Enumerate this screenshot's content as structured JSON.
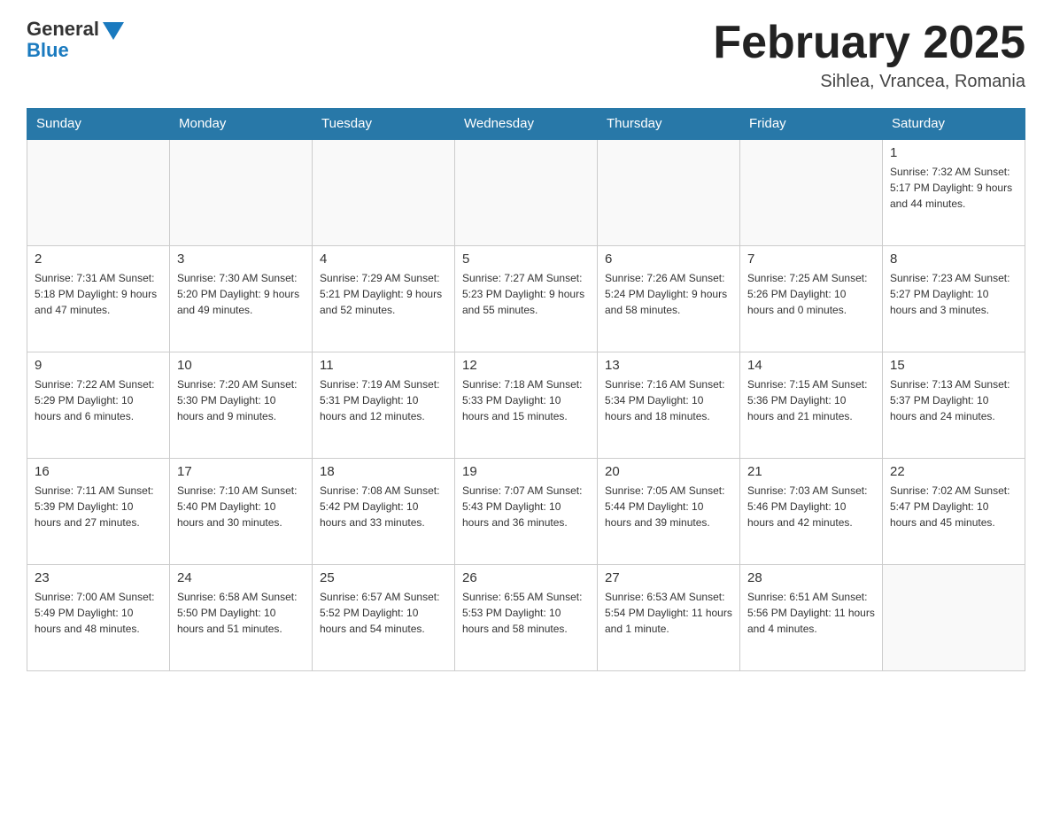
{
  "header": {
    "logo_general": "General",
    "logo_blue": "Blue",
    "month_title": "February 2025",
    "location": "Sihlea, Vrancea, Romania"
  },
  "days_of_week": [
    "Sunday",
    "Monday",
    "Tuesday",
    "Wednesday",
    "Thursday",
    "Friday",
    "Saturday"
  ],
  "weeks": [
    {
      "days": [
        {
          "number": "",
          "info": ""
        },
        {
          "number": "",
          "info": ""
        },
        {
          "number": "",
          "info": ""
        },
        {
          "number": "",
          "info": ""
        },
        {
          "number": "",
          "info": ""
        },
        {
          "number": "",
          "info": ""
        },
        {
          "number": "1",
          "info": "Sunrise: 7:32 AM\nSunset: 5:17 PM\nDaylight: 9 hours and 44 minutes."
        }
      ]
    },
    {
      "days": [
        {
          "number": "2",
          "info": "Sunrise: 7:31 AM\nSunset: 5:18 PM\nDaylight: 9 hours and 47 minutes."
        },
        {
          "number": "3",
          "info": "Sunrise: 7:30 AM\nSunset: 5:20 PM\nDaylight: 9 hours and 49 minutes."
        },
        {
          "number": "4",
          "info": "Sunrise: 7:29 AM\nSunset: 5:21 PM\nDaylight: 9 hours and 52 minutes."
        },
        {
          "number": "5",
          "info": "Sunrise: 7:27 AM\nSunset: 5:23 PM\nDaylight: 9 hours and 55 minutes."
        },
        {
          "number": "6",
          "info": "Sunrise: 7:26 AM\nSunset: 5:24 PM\nDaylight: 9 hours and 58 minutes."
        },
        {
          "number": "7",
          "info": "Sunrise: 7:25 AM\nSunset: 5:26 PM\nDaylight: 10 hours and 0 minutes."
        },
        {
          "number": "8",
          "info": "Sunrise: 7:23 AM\nSunset: 5:27 PM\nDaylight: 10 hours and 3 minutes."
        }
      ]
    },
    {
      "days": [
        {
          "number": "9",
          "info": "Sunrise: 7:22 AM\nSunset: 5:29 PM\nDaylight: 10 hours and 6 minutes."
        },
        {
          "number": "10",
          "info": "Sunrise: 7:20 AM\nSunset: 5:30 PM\nDaylight: 10 hours and 9 minutes."
        },
        {
          "number": "11",
          "info": "Sunrise: 7:19 AM\nSunset: 5:31 PM\nDaylight: 10 hours and 12 minutes."
        },
        {
          "number": "12",
          "info": "Sunrise: 7:18 AM\nSunset: 5:33 PM\nDaylight: 10 hours and 15 minutes."
        },
        {
          "number": "13",
          "info": "Sunrise: 7:16 AM\nSunset: 5:34 PM\nDaylight: 10 hours and 18 minutes."
        },
        {
          "number": "14",
          "info": "Sunrise: 7:15 AM\nSunset: 5:36 PM\nDaylight: 10 hours and 21 minutes."
        },
        {
          "number": "15",
          "info": "Sunrise: 7:13 AM\nSunset: 5:37 PM\nDaylight: 10 hours and 24 minutes."
        }
      ]
    },
    {
      "days": [
        {
          "number": "16",
          "info": "Sunrise: 7:11 AM\nSunset: 5:39 PM\nDaylight: 10 hours and 27 minutes."
        },
        {
          "number": "17",
          "info": "Sunrise: 7:10 AM\nSunset: 5:40 PM\nDaylight: 10 hours and 30 minutes."
        },
        {
          "number": "18",
          "info": "Sunrise: 7:08 AM\nSunset: 5:42 PM\nDaylight: 10 hours and 33 minutes."
        },
        {
          "number": "19",
          "info": "Sunrise: 7:07 AM\nSunset: 5:43 PM\nDaylight: 10 hours and 36 minutes."
        },
        {
          "number": "20",
          "info": "Sunrise: 7:05 AM\nSunset: 5:44 PM\nDaylight: 10 hours and 39 minutes."
        },
        {
          "number": "21",
          "info": "Sunrise: 7:03 AM\nSunset: 5:46 PM\nDaylight: 10 hours and 42 minutes."
        },
        {
          "number": "22",
          "info": "Sunrise: 7:02 AM\nSunset: 5:47 PM\nDaylight: 10 hours and 45 minutes."
        }
      ]
    },
    {
      "days": [
        {
          "number": "23",
          "info": "Sunrise: 7:00 AM\nSunset: 5:49 PM\nDaylight: 10 hours and 48 minutes."
        },
        {
          "number": "24",
          "info": "Sunrise: 6:58 AM\nSunset: 5:50 PM\nDaylight: 10 hours and 51 minutes."
        },
        {
          "number": "25",
          "info": "Sunrise: 6:57 AM\nSunset: 5:52 PM\nDaylight: 10 hours and 54 minutes."
        },
        {
          "number": "26",
          "info": "Sunrise: 6:55 AM\nSunset: 5:53 PM\nDaylight: 10 hours and 58 minutes."
        },
        {
          "number": "27",
          "info": "Sunrise: 6:53 AM\nSunset: 5:54 PM\nDaylight: 11 hours and 1 minute."
        },
        {
          "number": "28",
          "info": "Sunrise: 6:51 AM\nSunset: 5:56 PM\nDaylight: 11 hours and 4 minutes."
        },
        {
          "number": "",
          "info": ""
        }
      ]
    }
  ]
}
